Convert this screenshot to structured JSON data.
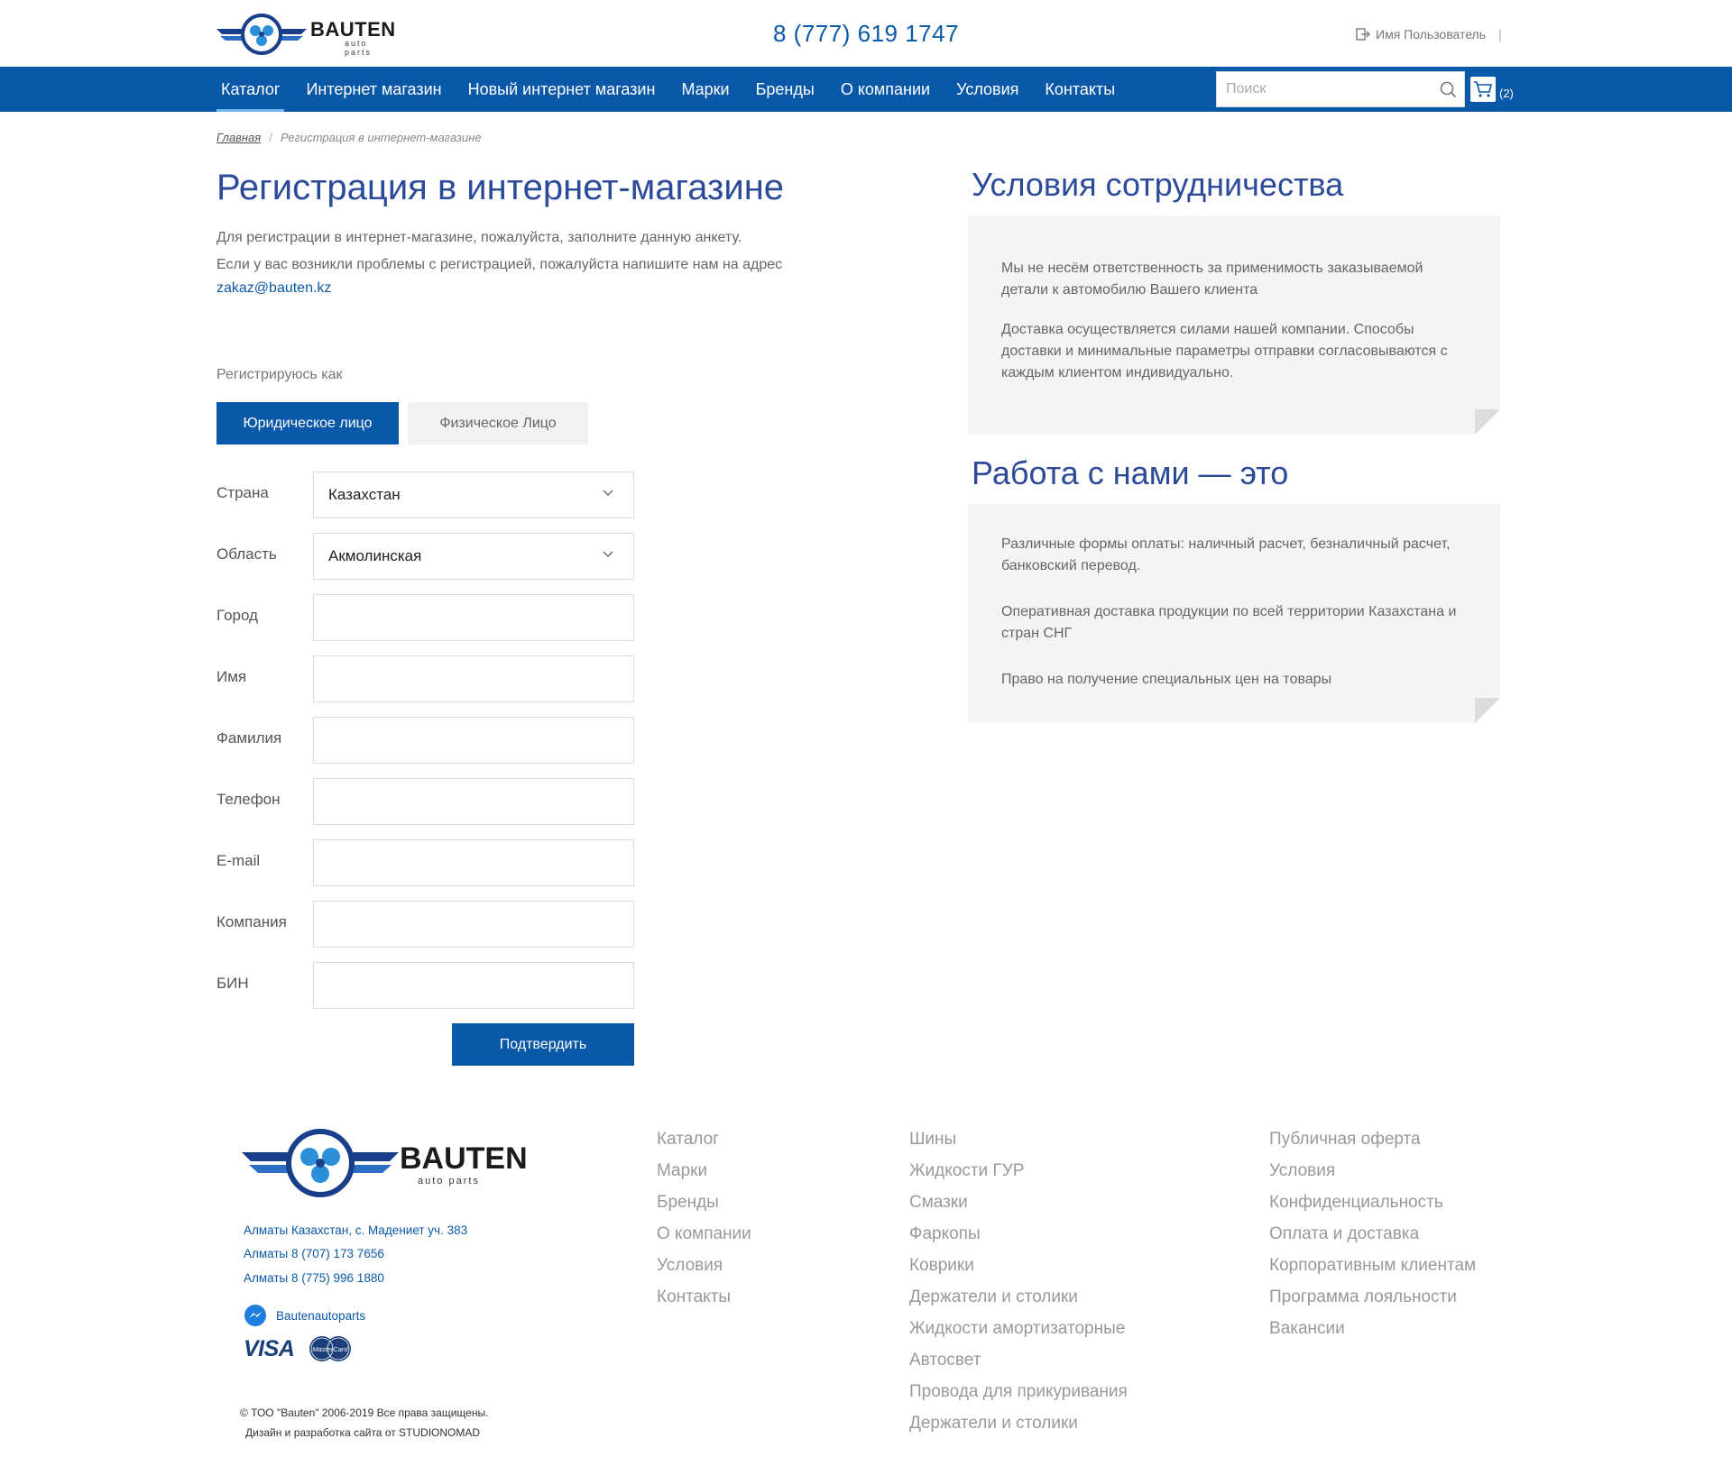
{
  "header": {
    "logo_brand": "BAUTEN",
    "logo_sub": "auto parts",
    "phone": "8 (777) 619 1747",
    "user_label": "Имя Пользователь",
    "user_separator": "|"
  },
  "nav": {
    "items": [
      {
        "label": "Каталог",
        "active": true
      },
      {
        "label": "Интернет магазин"
      },
      {
        "label": "Новый интернет магазин"
      },
      {
        "label": "Марки"
      },
      {
        "label": "Бренды"
      },
      {
        "label": "О компании"
      },
      {
        "label": "Условия"
      },
      {
        "label": "Контакты"
      }
    ],
    "search_placeholder": "Поиск",
    "cart_count": "(2)"
  },
  "breadcrumb": {
    "home": "Главная",
    "separator": "/",
    "current": "Регистрация в интернет-магазине"
  },
  "registration": {
    "title": "Регистрация в интернет-магазине",
    "intro_line1": "Для регистрации в интернет-магазине, пожалуйста, заполните данную анкету.",
    "intro_line2": "Если у вас возникли проблемы с регистрацией, пожалуйста напишите нам на адрес",
    "email": "zakaz@bauten.kz",
    "register_as": "Регистрируюсь как",
    "tab_legal": "Юридическое лицо",
    "tab_person": "Физическое Лицо",
    "fields": [
      {
        "label": "Страна",
        "value": "Казахстан",
        "select": true
      },
      {
        "label": "Область",
        "value": "Акмолинская",
        "select": true
      },
      {
        "label": "Город",
        "value": ""
      },
      {
        "label": "Имя",
        "value": ""
      },
      {
        "label": "Фамилия",
        "value": ""
      },
      {
        "label": "Телефон",
        "value": ""
      },
      {
        "label": "E-mail",
        "value": ""
      },
      {
        "label": "Компания",
        "value": ""
      },
      {
        "label": "БИН",
        "value": ""
      }
    ],
    "submit": "Подтвердить"
  },
  "sidebar": {
    "terms_title": "Условия сотрудничества",
    "terms_p1": "Мы не несём ответственность за применимость заказываемой детали к автомобилю Вашего клиента",
    "terms_p2": "Доставка осуществляется силами нашей компании. Способы доставки и минимальные параметры отправки согласовываются с каждым клиентом индивидуально.",
    "work_title": "Работа с нами — это",
    "work_p1": "Различные формы оплаты: наличный расчет, безналичный расчет, банковский перевод.",
    "work_p2": "Оперативная доставка продукции по всей территории Казахстана и стран СНГ",
    "work_p3": "Право на получение специальных цен на товары"
  },
  "footer": {
    "address": "Алматы Казахстан, с. Мадениет уч. 383",
    "phone1": "Алматы  8 (707) 173 7656",
    "phone2": "Алматы 8 (775) 996 1880",
    "social": "Bautenautoparts",
    "visa": "VISA",
    "mastercard": "MasterCard",
    "copyright": "© ТОО \"Bauten\" 2006-2019 Все права защищены.",
    "credits": "Дизайн и разработка сайта от  STUDIONOMAD",
    "col1": [
      "Каталог",
      "Марки",
      "Бренды",
      "О компании",
      "Условия",
      "Контакты"
    ],
    "col2": [
      "Шины",
      "Жидкости ГУР",
      "Смазки",
      "Фаркопы",
      "Коврики",
      "Держатели и столики",
      "Жидкости амортизаторные",
      "Автосвет",
      "Провода для прикуривания",
      "Держатели и столики"
    ],
    "col3": [
      "Публичная оферта",
      "Условия",
      "Конфиденциальность",
      "Оплата и доставка",
      "Корпоративным клиентам",
      "Программа лояльности",
      "Вакансии"
    ]
  },
  "colors": {
    "brand_blue": "#0a58a8",
    "title_blue": "#2c4a9a",
    "note_bg": "#f4f4f4"
  }
}
